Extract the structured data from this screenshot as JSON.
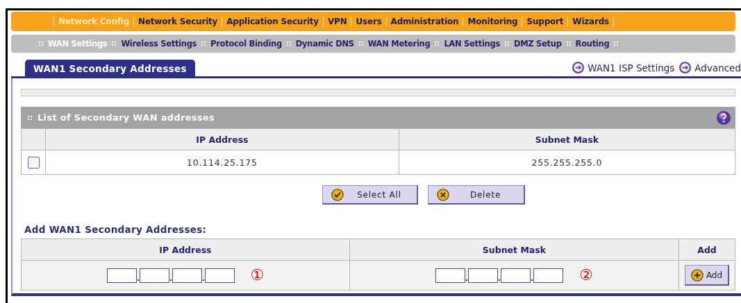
{
  "main_nav": [
    {
      "label": "Network Config",
      "selected": true
    },
    {
      "label": "Network Security",
      "selected": false
    },
    {
      "label": "Application Security",
      "selected": false
    },
    {
      "label": "VPN",
      "selected": false
    },
    {
      "label": "Users",
      "selected": false
    },
    {
      "label": "Administration",
      "selected": false
    },
    {
      "label": "Monitoring",
      "selected": false
    },
    {
      "label": "Support",
      "selected": false
    },
    {
      "label": "Wizards",
      "selected": false
    }
  ],
  "sub_nav": [
    {
      "label": "WAN Settings",
      "selected": true
    },
    {
      "label": "Wireless Settings",
      "selected": false
    },
    {
      "label": "Protocol Binding",
      "selected": false
    },
    {
      "label": "Dynamic DNS",
      "selected": false
    },
    {
      "label": "WAN Metering",
      "selected": false
    },
    {
      "label": "LAN Settings",
      "selected": false
    },
    {
      "label": "DMZ Setup",
      "selected": false
    },
    {
      "label": "Routing",
      "selected": false
    }
  ],
  "tab": {
    "label": "WAN1 Secondary Addresses"
  },
  "links": [
    "WAN1 ISP Settings",
    "Advanced"
  ],
  "list_section": {
    "title": "List of Secondary WAN addresses",
    "columns": [
      "IP Address",
      "Subnet Mask"
    ],
    "rows": [
      {
        "checked": false,
        "ip": "10.114.25.175",
        "mask": "255.255.255.0"
      }
    ],
    "buttons": [
      {
        "label": "Select All",
        "kind": "check"
      },
      {
        "label": "Delete",
        "kind": "cross"
      }
    ]
  },
  "add_section": {
    "title": "Add WAN1 Secondary Addresses:",
    "columns": [
      "IP Address",
      "Subnet Mask",
      "Add"
    ],
    "callouts": [
      "①",
      "②"
    ],
    "add_button": "Add"
  }
}
